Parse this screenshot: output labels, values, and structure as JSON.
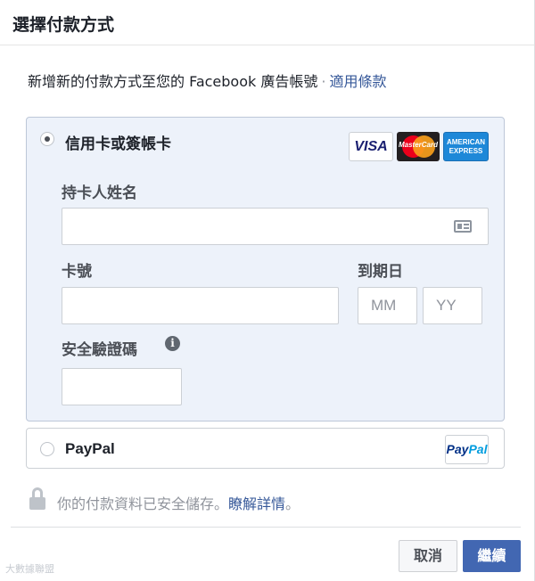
{
  "dialog": {
    "title": "選擇付款方式"
  },
  "intro": {
    "text": "新增新的付款方式至您的 Facebook 廣告帳號",
    "separator": "·",
    "terms_link": "適用條款"
  },
  "card_option": {
    "label": "信用卡或簽帳卡",
    "selected": true,
    "logos": {
      "visa": "VISA",
      "mastercard": "MasterCard",
      "amex_line1": "AMERICAN",
      "amex_line2": "EXPRESS"
    },
    "cardholder_label": "持卡人姓名",
    "cardholder_value": "",
    "card_number_label": "卡號",
    "card_number_value": "",
    "expiry_label": "到期日",
    "expiry_month_placeholder": "MM",
    "expiry_year_placeholder": "YY",
    "cvv_label": "安全驗證碼",
    "cvv_value": "",
    "icons": [
      "id-card-icon",
      "info-icon"
    ]
  },
  "paypal_option": {
    "label": "PayPal",
    "selected": false,
    "logo_pay": "Pay",
    "logo_pal": "Pal"
  },
  "security": {
    "text": "你的付款資料已安全儲存。",
    "link": "瞭解詳情",
    "suffix": "。"
  },
  "buttons": {
    "cancel": "取消",
    "continue": "繼續"
  },
  "watermark": "大數據聯盟",
  "colors": {
    "primary": "#4267b2",
    "link": "#365899",
    "selected_bg": "#edf2fa",
    "border": "#ccd0d5"
  }
}
